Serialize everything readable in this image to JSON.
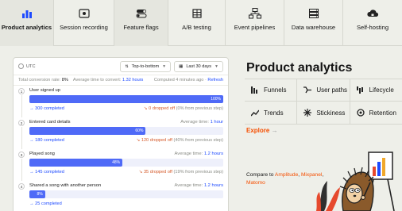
{
  "tabs": [
    {
      "label": "Product analytics",
      "icon": "bar-chart-icon",
      "active": true
    },
    {
      "label": "Session recording",
      "icon": "record-icon",
      "active": false
    },
    {
      "label": "Feature flags",
      "icon": "toggle-icon",
      "active": false
    },
    {
      "label": "A/B testing",
      "icon": "flask-icon",
      "active": false
    },
    {
      "label": "Event pipelines",
      "icon": "pipeline-icon",
      "active": false
    },
    {
      "label": "Data warehouse",
      "icon": "server-icon",
      "active": false
    },
    {
      "label": "Self-hosting",
      "icon": "cloud-icon",
      "active": false
    }
  ],
  "card": {
    "timezone": "UTC",
    "layout_select": "Top-to-bottom",
    "date_select": "Last 30 days",
    "total_rate_label": "Total conversion rate:",
    "total_rate": "8%",
    "avg_time_label": "Average time to convert:",
    "avg_time": "1.32 hours",
    "computed": "Computed 4 minutes ago",
    "refresh": "Refresh",
    "steps": [
      {
        "num": "1",
        "name": "User signed up",
        "pct": 100,
        "pct_label": "100%",
        "completed": "300",
        "completed_label": "completed",
        "dropped": "0",
        "dropped_label": "dropped off",
        "dropped_note": "(0% from previous step)",
        "avg_label": "",
        "avg_value": ""
      },
      {
        "num": "2",
        "name": "Entered card details",
        "pct": 60,
        "pct_label": "60%",
        "completed": "180",
        "completed_label": "completed",
        "dropped": "120",
        "dropped_label": "dropped off",
        "dropped_note": "(40% from previous step)",
        "avg_label": "Average time:",
        "avg_value": "1 hour"
      },
      {
        "num": "3",
        "name": "Played song",
        "pct": 48,
        "pct_label": "48%",
        "completed": "145",
        "completed_label": "completed",
        "dropped": "35",
        "dropped_label": "dropped off",
        "dropped_note": "(19% from previous step)",
        "avg_label": "Average time:",
        "avg_value": "1.2 hours"
      },
      {
        "num": "4",
        "name": "Shared a song with another person",
        "pct": 8,
        "pct_label": "8%",
        "completed": "25",
        "completed_label": "completed",
        "dropped": "",
        "dropped_label": "",
        "dropped_note": "",
        "avg_label": "Average time:",
        "avg_value": "1.2 hours"
      }
    ]
  },
  "panel": {
    "title": "Product analytics",
    "features": [
      {
        "label": "Funnels",
        "icon": "funnel-icon"
      },
      {
        "label": "User paths",
        "icon": "paths-icon"
      },
      {
        "label": "Lifecycle",
        "icon": "lifecycle-icon"
      },
      {
        "label": "Trends",
        "icon": "trends-icon"
      },
      {
        "label": "Stickiness",
        "icon": "stickiness-icon"
      },
      {
        "label": "Retention",
        "icon": "retention-icon"
      }
    ],
    "explore": "Explore",
    "explore_arrow": "→",
    "compare_prefix": "Compare to",
    "compare_links": [
      "Amplitude",
      "Mixpanel",
      "Matomo"
    ],
    "compare_separators": [
      ",",
      ","
    ]
  },
  "colors": {
    "accent": "#f54e00",
    "bar": "#4f6af7",
    "link": "#1d4aff",
    "background": "#eeefe9"
  }
}
